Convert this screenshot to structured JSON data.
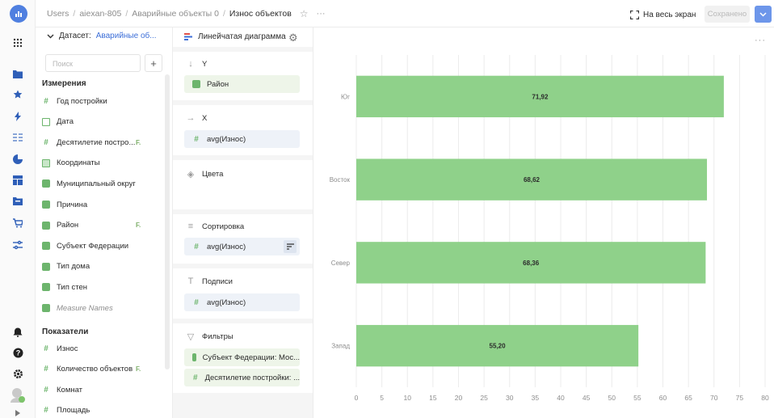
{
  "header": {
    "breadcrumbs": [
      "Users",
      "aiexan-805",
      "Аварийные объекты 0"
    ],
    "current": "Износ объектов",
    "fullscreen_label": "На весь экран",
    "saved_label": "Сохранено"
  },
  "dataset": {
    "label": "Датасет:",
    "name": "Аварийные об...",
    "search_placeholder": "Поиск",
    "dimensions_title": "Измерения",
    "dimensions": [
      {
        "label": "Год постройки",
        "icon": "hash-icon",
        "fx": ""
      },
      {
        "label": "Дата",
        "icon": "calendar-icon",
        "fx": ""
      },
      {
        "label": "Десятилетие постро...",
        "icon": "hash-icon",
        "fx": "F."
      },
      {
        "label": "Координаты",
        "icon": "geo-icon",
        "fx": ""
      },
      {
        "label": "Муниципальный округ",
        "icon": "string-icon",
        "fx": ""
      },
      {
        "label": "Причина",
        "icon": "string-icon",
        "fx": ""
      },
      {
        "label": "Район",
        "icon": "string-icon",
        "fx": "F."
      },
      {
        "label": "Субъект Федерации",
        "icon": "string-icon",
        "fx": ""
      },
      {
        "label": "Тип дома",
        "icon": "string-icon",
        "fx": ""
      },
      {
        "label": "Тип стен",
        "icon": "string-icon",
        "fx": ""
      },
      {
        "label": "Measure Names",
        "icon": "string-icon",
        "fx": "",
        "italic": true
      }
    ],
    "measures_title": "Показатели",
    "measures": [
      {
        "label": "Износ",
        "fx": ""
      },
      {
        "label": "Количество объектов",
        "fx": "F."
      },
      {
        "label": "Комнат",
        "fx": ""
      },
      {
        "label": "Площадь",
        "fx": ""
      }
    ]
  },
  "wizard": {
    "chart_type": "Линейчатая диаграмма",
    "y_title": "Y",
    "y_field": "Район",
    "x_title": "X",
    "x_field": "avg(Износ)",
    "colors_title": "Цвета",
    "sort_title": "Сортировка",
    "sort_field": "avg(Износ)",
    "labels_title": "Подписи",
    "labels_field": "avg(Износ)",
    "filters_title": "Фильтры",
    "filters": [
      "Субъект Федерации: Мос...",
      "Десятилетие постройки: ..."
    ]
  },
  "colors": {
    "bar": "#8fd18a",
    "accent": "#4f7fe0",
    "grid": "#ececec"
  },
  "chart_data": {
    "type": "bar",
    "orientation": "horizontal",
    "categories": [
      "Юг",
      "Восток",
      "Север",
      "Запад"
    ],
    "values": [
      71.92,
      68.62,
      68.36,
      55.2
    ],
    "data_labels": [
      "71,92",
      "68,62",
      "68,36",
      "55,20"
    ],
    "xlim": [
      0,
      80
    ],
    "xticks": [
      0,
      5,
      10,
      15,
      20,
      25,
      30,
      35,
      40,
      45,
      50,
      55,
      60,
      65,
      70,
      75,
      80
    ],
    "grid": true,
    "legend": "none"
  }
}
